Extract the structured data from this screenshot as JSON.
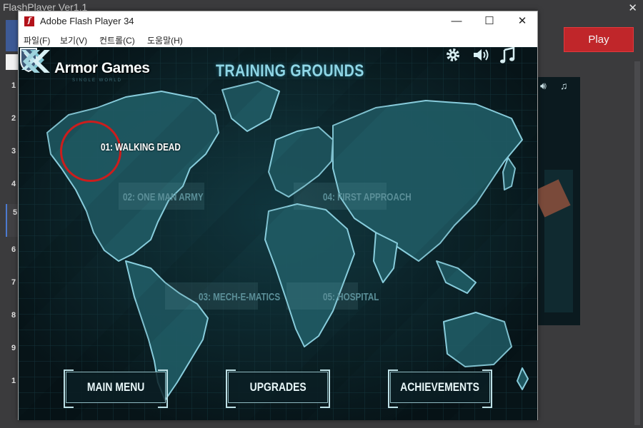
{
  "outer_window": {
    "title": "FlashPlayer Ver1.1",
    "close_glyph": "✕",
    "play_label": "Play",
    "row_numbers": [
      "1",
      "2",
      "3",
      "4",
      "5",
      "6",
      "7",
      "8",
      "9",
      "1"
    ]
  },
  "flash_window": {
    "title": "Adobe Flash Player 34",
    "minimize_glyph": "—",
    "maximize_glyph": "☐",
    "close_glyph": "✕",
    "menu": [
      "파일(F)",
      "보기(V)",
      "컨트롤(C)",
      "도움말(H)"
    ]
  },
  "game": {
    "brand": "Armor Games",
    "brand_sub": "SINGLE WORLD",
    "title": "TRAINING GROUNDS",
    "levels": [
      {
        "label": "01: WALKING DEAD",
        "state": "active"
      },
      {
        "label": "02: ONE MAN ARMY",
        "state": "locked"
      },
      {
        "label": "03: MECH-E-MATICS",
        "state": "locked"
      },
      {
        "label": "04: FIRST APPROACH",
        "state": "locked"
      },
      {
        "label": "05: HOSPITAL",
        "state": "locked"
      }
    ],
    "buttons": {
      "main_menu": "MAIN MENU",
      "upgrades": "UPGRADES",
      "achievements": "ACHIEVEMENTS"
    },
    "icons": [
      "gear-icon",
      "speaker-icon",
      "music-note-icon",
      "double-chevron-right-icon"
    ]
  },
  "colors": {
    "play_button": "#c0262a",
    "map_land": "#1f5962",
    "map_outline": "#8fd6e6",
    "highlight_circle": "#cc1d1d"
  }
}
